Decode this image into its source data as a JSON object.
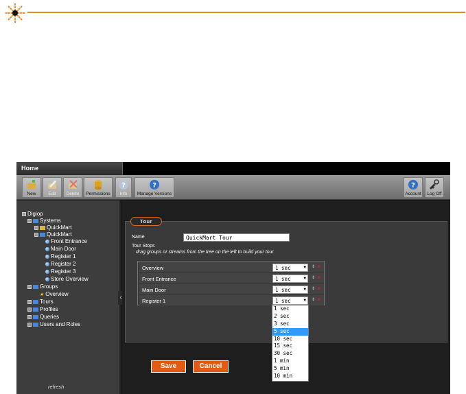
{
  "toolbar": {
    "new": "New",
    "edit": "Edit",
    "delete": "Delete",
    "permissions": "Permissions",
    "info": "Info",
    "manage_versions": "Manage Versions",
    "account": "Account",
    "log_off": "Log Off"
  },
  "tabs": {
    "home": "Home"
  },
  "tree": {
    "root": "Digiop",
    "systems": "Systems",
    "quickmart_1": "QuickMart",
    "quickmart_2": "QuickMart",
    "cam_front": "Front Entrance",
    "cam_main": "Main Door",
    "cam_reg1": "Register 1",
    "cam_reg2": "Register 2",
    "cam_reg3": "Register 3",
    "cam_store": "Store Overview",
    "groups": "Groups",
    "overview": "Overview",
    "tours": "Tours",
    "profiles": "Profiles",
    "queries": "Queries",
    "users_roles": "Users and Roles",
    "refresh": "refresh"
  },
  "form": {
    "section": "Tour",
    "name_label": "Name",
    "name_value": "QuickMart Tour",
    "stops_label": "Tour Stops",
    "hint": "drag groups or streams from the tree on the left to build your tour",
    "stops": [
      {
        "name": "Overview",
        "interval": "1 sec"
      },
      {
        "name": "Front Entrance",
        "interval": "1 sec"
      },
      {
        "name": "Main Door",
        "interval": "1 sec"
      },
      {
        "name": "Register 1",
        "interval": "1 sec"
      }
    ],
    "save": "Save",
    "cancel": "Cancel"
  },
  "dropdown": {
    "options": [
      "1 sec",
      "2 sec",
      "3 sec",
      "5 sec",
      "10 sec",
      "15 sec",
      "30 sec",
      "1 min",
      "5 min",
      "10 min"
    ],
    "highlighted": "5 sec"
  },
  "icons": {
    "logo": "starburst-logo-icon",
    "reorder": "up-down-arrows-icon",
    "remove": "red-x-icon"
  },
  "colors": {
    "accent_orange": "#e45a12",
    "rule_orange": "#e58a2a",
    "highlight_blue": "#3399ff",
    "remove_red": "#e02020"
  }
}
